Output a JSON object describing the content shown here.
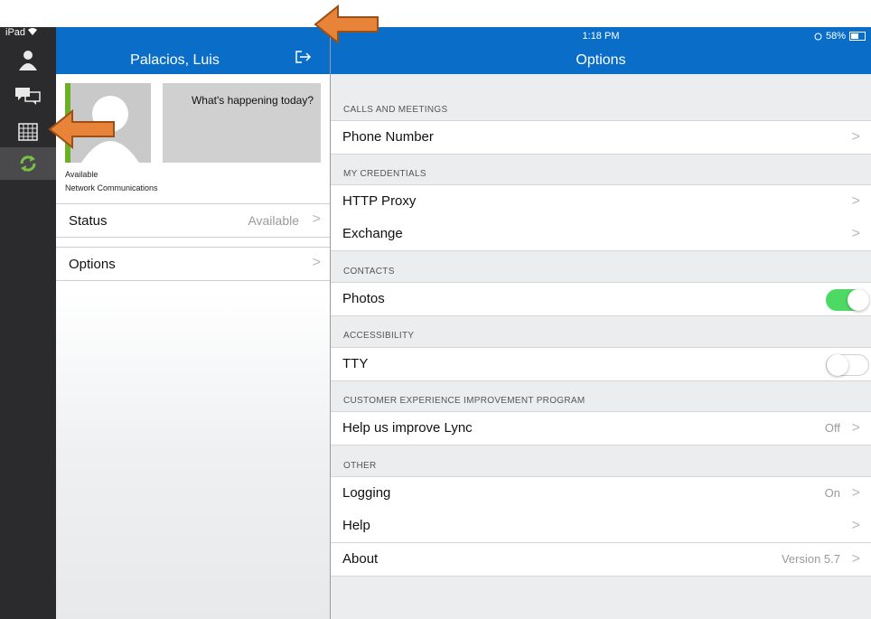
{
  "status_bar": {
    "device": "iPad",
    "time": "1:18 PM",
    "battery": "58%"
  },
  "profile": {
    "name": "Palacios, Luis",
    "note": "What's happening today?",
    "availability": "Available",
    "location": "Network Communications",
    "rows": [
      {
        "label": "Status",
        "value": "Available"
      },
      {
        "label": "Options",
        "value": ""
      }
    ]
  },
  "options": {
    "title": "Options",
    "sections": {
      "calls": "CALLS AND MEETINGS",
      "credentials": "MY CREDENTIALS",
      "contacts": "CONTACTS",
      "accessibility": "ACCESSIBILITY",
      "ceip": "CUSTOMER EXPERIENCE IMPROVEMENT PROGRAM",
      "other": "OTHER"
    },
    "phone_number": "Phone Number",
    "http_proxy": "HTTP Proxy",
    "exchange": "Exchange",
    "photos": {
      "label": "Photos",
      "on": true
    },
    "tty": {
      "label": "TTY",
      "on": false
    },
    "improve": {
      "label": "Help us improve Lync",
      "value": "Off"
    },
    "logging": {
      "label": "Logging",
      "value": "On"
    },
    "help": "Help",
    "about": {
      "label": "About",
      "value": "Version 5.7"
    }
  },
  "colors": {
    "header_blue": "#0a6ec9",
    "toggle_on": "#4cd964",
    "rail": "#2b2b2d",
    "arrow_orange": "#e8833a"
  }
}
